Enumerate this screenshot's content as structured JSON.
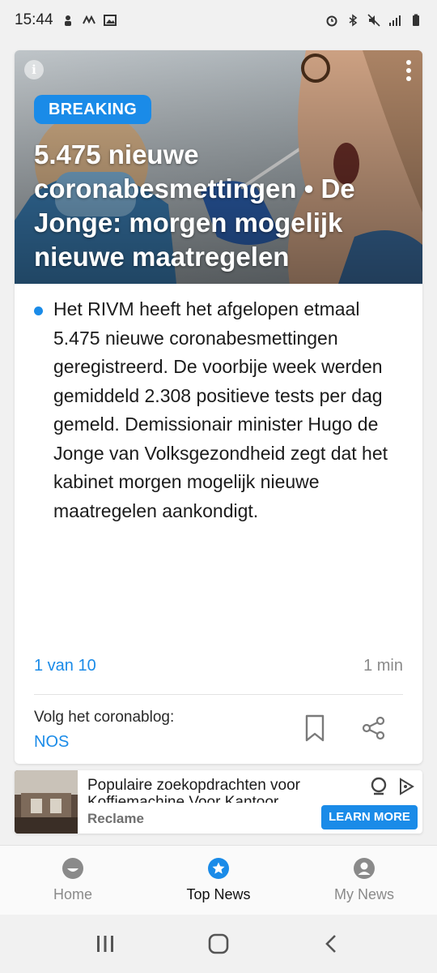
{
  "status_bar": {
    "time": "15:44"
  },
  "card": {
    "badge": "BREAKING",
    "headline": "5.475 nieuwe coronabesmettingen • De Jonge: morgen mogelijk nieuwe maatregelen",
    "body": "Het RIVM heeft het afgelopen etmaal 5.475 nieuwe coronabesmettingen geregistreerd. De voorbije week werden gemiddeld 2.308 positieve tests per dag gemeld. Demissionair minister Hugo de Jonge van Volksgezondheid zegt dat het kabinet morgen mogelijk nieuwe maatregelen aankondigt.",
    "pager": "1 van 10",
    "read_time": "1 min",
    "follow_label": "Volg het coronablog:",
    "follow_link": "NOS"
  },
  "ad": {
    "title": "Populaire zoekopdrachten voor Koffiemachine Voor Kantoor",
    "label": "Reclame",
    "cta": "LEARN MORE"
  },
  "bottom_nav": {
    "items": [
      {
        "label": "Home",
        "icon": "home-face-icon"
      },
      {
        "label": "Top News",
        "icon": "star-icon"
      },
      {
        "label": "My News",
        "icon": "user-icon"
      }
    ]
  },
  "colors": {
    "accent": "#1a8be8",
    "background": "#f1f1f1"
  }
}
